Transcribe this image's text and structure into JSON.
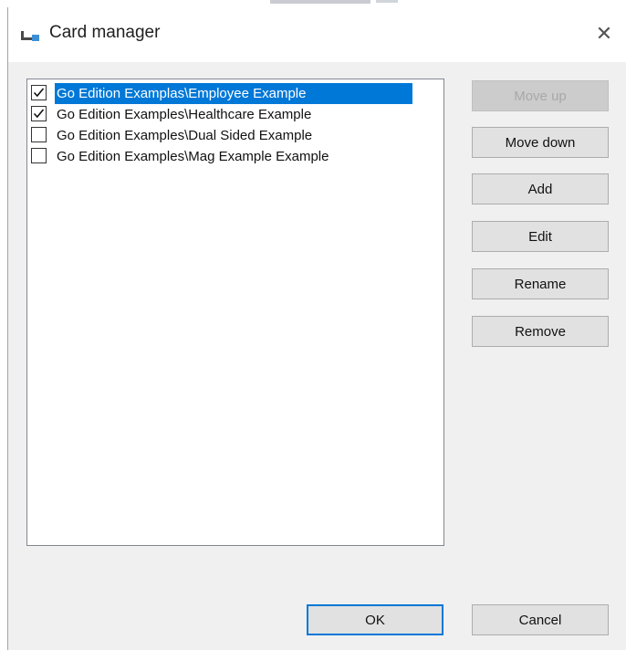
{
  "window": {
    "title": "Card manager",
    "app_icon": "card-manager-icon",
    "close_glyph": "✕"
  },
  "card_list": [
    {
      "label": "Go Edition Examplas\\Employee Example",
      "checked": true,
      "selected": true
    },
    {
      "label": "Go Edition Examples\\Healthcare Example",
      "checked": true,
      "selected": false
    },
    {
      "label": "Go Edition Examples\\Dual Sided Example",
      "checked": false,
      "selected": false
    },
    {
      "label": "Go Edition Examples\\Mag Example Example",
      "checked": false,
      "selected": false
    }
  ],
  "buttons": {
    "move_up": "Move up",
    "move_down": "Move down",
    "add": "Add",
    "edit": "Edit",
    "rename": "Rename",
    "remove": "Remove",
    "ok": "OK",
    "cancel": "Cancel"
  },
  "colors": {
    "selection": "#0078d7",
    "dialog_bg": "#f0f0f0",
    "button_bg": "#e1e1e1"
  }
}
